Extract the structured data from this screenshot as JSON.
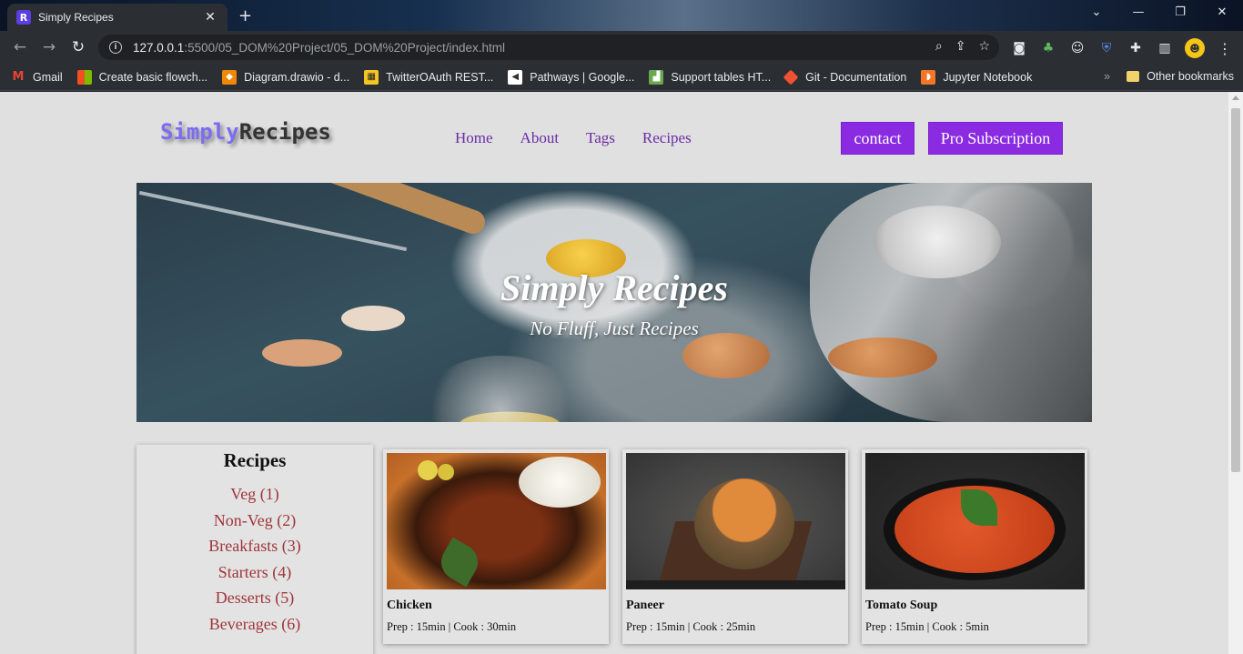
{
  "browser": {
    "tab_title": "Simply Recipes",
    "favicon_letter": "R",
    "url_host": "127.0.0.1",
    "url_path": ":5500/05_DOM%20Project/05_DOM%20Project/index.html",
    "bookmarks": [
      {
        "label": "Gmail",
        "icon": "gmail-icon",
        "color": "#ea4335"
      },
      {
        "label": "Create basic flowch...",
        "icon": "microsoft-icon",
        "color": "#f25022"
      },
      {
        "label": "Diagram.drawio - d...",
        "icon": "drawio-icon",
        "color": "#f08705"
      },
      {
        "label": "TwitterOAuth REST...",
        "icon": "twitteroauth-icon",
        "color": "#f3c623"
      },
      {
        "label": "Pathways | Google...",
        "icon": "google-pathways-icon",
        "color": "#ffffff"
      },
      {
        "label": "Support tables HT...",
        "icon": "caniuse-icon",
        "color": "#6aa84f"
      },
      {
        "label": "Git - Documentation",
        "icon": "git-icon",
        "color": "#f05133"
      },
      {
        "label": "Jupyter Notebook",
        "icon": "jupyter-icon",
        "color": "#f37626"
      }
    ],
    "other_bookmarks": "Other bookmarks",
    "more_bookmarks_glyph": "»"
  },
  "site": {
    "logo_part1": "Simply",
    "logo_part2": "Recipes",
    "nav": [
      "Home",
      "About",
      "Tags",
      "Recipes"
    ],
    "contact_label": "contact",
    "pro_label": "Pro Subscription",
    "hero_title": "Simply Recipes",
    "hero_subtitle": "No Fluff, Just Recipes",
    "sidebar_title": "Recipes",
    "categories": [
      "Veg (1)",
      "Non-Veg (2)",
      "Breakfasts (3)",
      "Starters (4)",
      "Desserts (5)",
      "Beverages (6)"
    ],
    "recipes": [
      {
        "name": "Chicken",
        "meta": "Prep : 15min | Cook : 30min"
      },
      {
        "name": "Paneer",
        "meta": "Prep : 15min | Cook : 25min"
      },
      {
        "name": "Tomato Soup",
        "meta": "Prep : 15min | Cook : 5min"
      }
    ]
  },
  "colors": {
    "accent": "#8a2be2",
    "nav_link": "#6a2ca5",
    "category_link": "#a0353a",
    "logo_primary": "#7c6cf0",
    "page_bg": "#e0e0e0"
  }
}
